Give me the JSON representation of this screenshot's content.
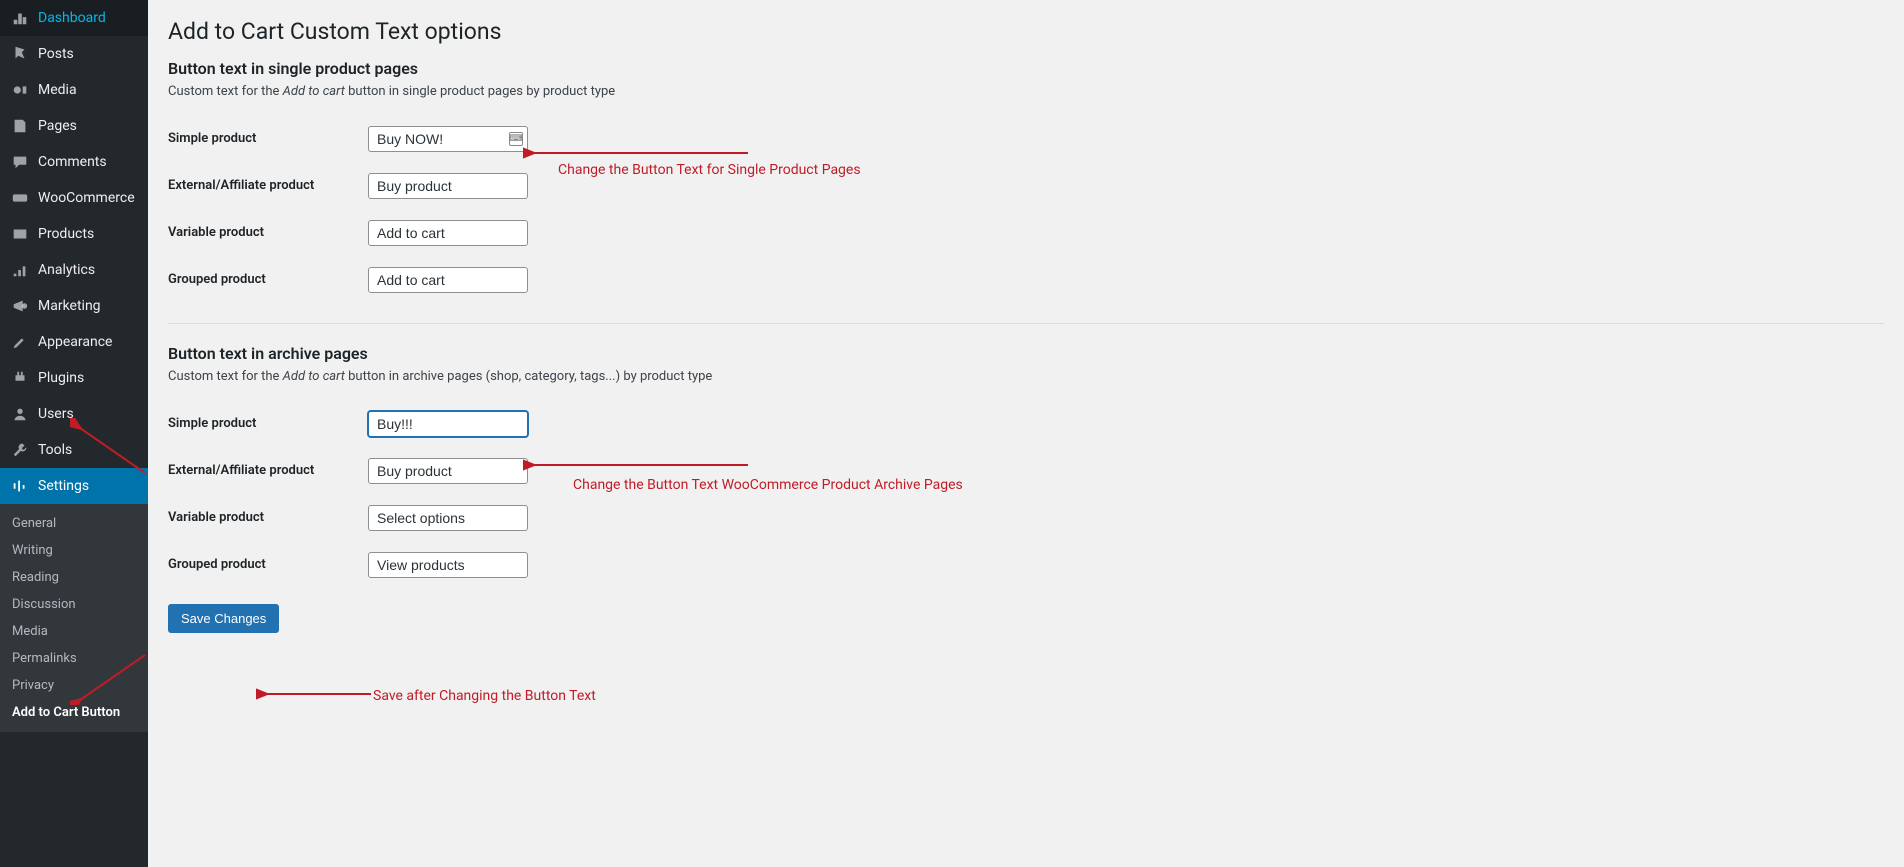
{
  "sidebar": {
    "items": [
      {
        "label": "Dashboard"
      },
      {
        "label": "Posts"
      },
      {
        "label": "Media"
      },
      {
        "label": "Pages"
      },
      {
        "label": "Comments"
      },
      {
        "label": "WooCommerce"
      },
      {
        "label": "Products"
      },
      {
        "label": "Analytics"
      },
      {
        "label": "Marketing"
      },
      {
        "label": "Appearance"
      },
      {
        "label": "Plugins"
      },
      {
        "label": "Users"
      },
      {
        "label": "Tools"
      },
      {
        "label": "Settings"
      }
    ],
    "submenu": [
      {
        "label": "General"
      },
      {
        "label": "Writing"
      },
      {
        "label": "Reading"
      },
      {
        "label": "Discussion"
      },
      {
        "label": "Media"
      },
      {
        "label": "Permalinks"
      },
      {
        "label": "Privacy"
      },
      {
        "label": "Add to Cart Button"
      }
    ]
  },
  "page": {
    "title": "Add to Cart Custom Text options",
    "section1_title": "Button text in single product pages",
    "section1_desc_pre": "Custom text for the ",
    "section1_desc_em": "Add to cart",
    "section1_desc_post": " button in single product pages by product type",
    "section2_title": "Button text in archive pages",
    "section2_desc_pre": "Custom text for the ",
    "section2_desc_em": "Add to cart",
    "section2_desc_post": " button in archive pages (shop, category, tags...) by product type",
    "labels": {
      "simple": "Simple product",
      "external": "External/Affiliate product",
      "variable": "Variable product",
      "grouped": "Grouped product"
    },
    "single": {
      "simple": "Buy NOW!",
      "external": "Buy product",
      "variable": "Add to cart",
      "grouped": "Add to cart"
    },
    "archive": {
      "simple": "Buy!!!",
      "external": "Buy product",
      "variable": "Select options",
      "grouped": "View products"
    },
    "save_button": "Save Changes"
  },
  "annotations": {
    "a1": "Change the Button Text for Single Product Pages",
    "a2": "Change the Button Text WooCommerce Product Archive Pages",
    "a3": "Save after Changing the Button Text"
  }
}
